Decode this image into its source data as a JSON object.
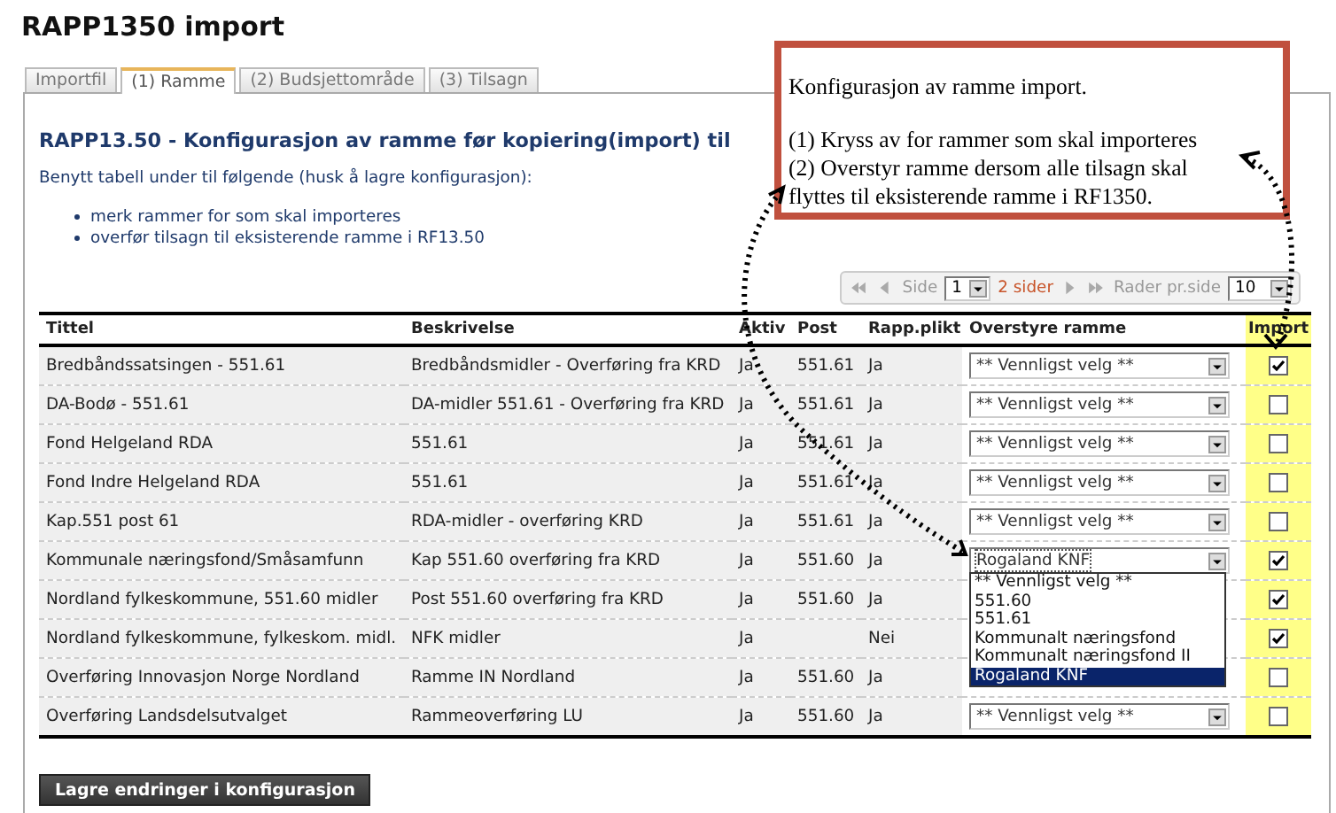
{
  "page_title": "RAPP1350 import",
  "tabs": [
    {
      "label": "Importfil",
      "selected": false
    },
    {
      "label": "(1) Ramme",
      "selected": true
    },
    {
      "label": "(2) Budsjettområde",
      "selected": false
    },
    {
      "label": "(3) Tilsagn",
      "selected": false
    }
  ],
  "heading": "RAPP13.50 - Konfigurasjon av ramme før kopiering(import) til",
  "intro": "Benytt tabell under til følgende (husk å lagre konfigurasjon):",
  "bullets": [
    "merk rammer for som skal importeres",
    "overfør tilsagn til eksisterende ramme i RF13.50"
  ],
  "pager": {
    "page_label": "Side",
    "page": "1",
    "pages": "2 sider",
    "rows_label": "Rader pr.side",
    "rows": "10"
  },
  "table": {
    "columns": [
      "Tittel",
      "Beskrivelse",
      "Aktiv",
      "Post",
      "Rapp.plikt",
      "Overstyre ramme",
      "Import"
    ],
    "rows": [
      {
        "title": "Bredbåndssatsingen - 551.61",
        "description": "Bredbåndsmidler - Overføring fra KRD",
        "aktiv": "Ja",
        "post": "551.61",
        "rapp": "Ja",
        "override": "** Vennligst velg **",
        "import": true
      },
      {
        "title": "DA-Bodø - 551.61",
        "description": "DA-midler 551.61 - Overføring fra KRD",
        "aktiv": "Ja",
        "post": "551.61",
        "rapp": "Ja",
        "override": "** Vennligst velg **",
        "import": false
      },
      {
        "title": "Fond Helgeland RDA",
        "description": "551.61",
        "aktiv": "Ja",
        "post": "551.61",
        "rapp": "Ja",
        "override": "** Vennligst velg **",
        "import": false
      },
      {
        "title": "Fond Indre Helgeland RDA",
        "description": "551.61",
        "aktiv": "Ja",
        "post": "551.61",
        "rapp": "Ja",
        "override": "** Vennligst velg **",
        "import": false
      },
      {
        "title": "Kap.551 post 61",
        "description": "RDA-midler - overføring KRD",
        "aktiv": "Ja",
        "post": "551.61",
        "rapp": "Ja",
        "override": "** Vennligst velg **",
        "import": false
      },
      {
        "title": "Kommunale næringsfond/Småsamfunn",
        "description": "Kap 551.60 overføring fra KRD",
        "aktiv": "Ja",
        "post": "551.60",
        "rapp": "Ja",
        "override": "Rogaland KNF",
        "open": true,
        "import": true
      },
      {
        "title": "Nordland fylkeskommune, 551.60 midler",
        "description": "Post 551.60 overføring fra KRD",
        "aktiv": "Ja",
        "post": "551.60",
        "rapp": "Ja",
        "import": true
      },
      {
        "title": "Nordland fylkeskommune, fylkeskom. midl.",
        "description": "NFK midler",
        "aktiv": "Ja",
        "post": "",
        "rapp": "Nei",
        "import": true
      },
      {
        "title": "Overføring Innovasjon Norge Nordland",
        "description": "Ramme IN Nordland",
        "aktiv": "Ja",
        "post": "551.60",
        "rapp": "Ja",
        "import": false
      },
      {
        "title": "Overføring Landsdelsutvalget",
        "description": "Rammeoverføring LU",
        "aktiv": "Ja",
        "post": "551.60",
        "rapp": "Ja",
        "override": "** Vennligst velg **",
        "import": false
      }
    ]
  },
  "dropdown_options": [
    {
      "label": "** Vennligst velg **",
      "selected": false
    },
    {
      "label": "551.60",
      "selected": false
    },
    {
      "label": "551.61",
      "selected": false
    },
    {
      "label": "Kommunalt næringsfond",
      "selected": false
    },
    {
      "label": "Kommunalt næringsfond II",
      "selected": false
    },
    {
      "label": "Rogaland KNF",
      "selected": true
    }
  ],
  "save_button": "Lagre endringer i konfigurasjon",
  "callout": {
    "title": "Konfigurasjon av ramme import.",
    "lines": [
      "(1) Kryss av for rammer som skal importeres",
      "(2) Overstyr ramme dersom alle tilsagn skal flyttes til eksisterende ramme i RF1350."
    ]
  }
}
